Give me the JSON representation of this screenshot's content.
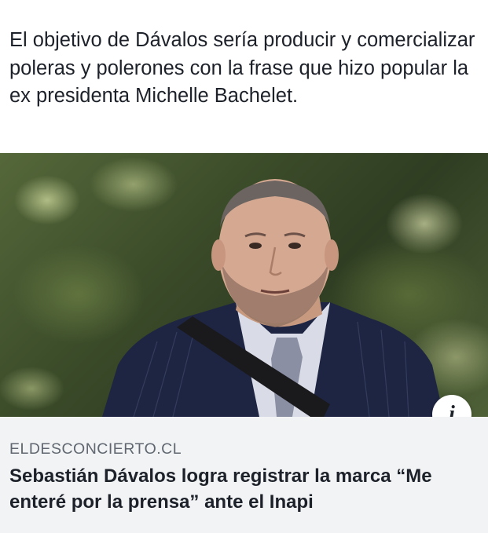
{
  "post": {
    "text": "El objetivo de Dávalos sería producir y comercializar poleras y polerones con la frase que hizo popular la ex presidenta Michelle Bachelet."
  },
  "link_card": {
    "domain": "ELDESCONCIERTO.CL",
    "headline": "Sebastián Dávalos logra registrar la marca “Me enteré por la prensa” ante el Inapi",
    "info_button": "i"
  }
}
